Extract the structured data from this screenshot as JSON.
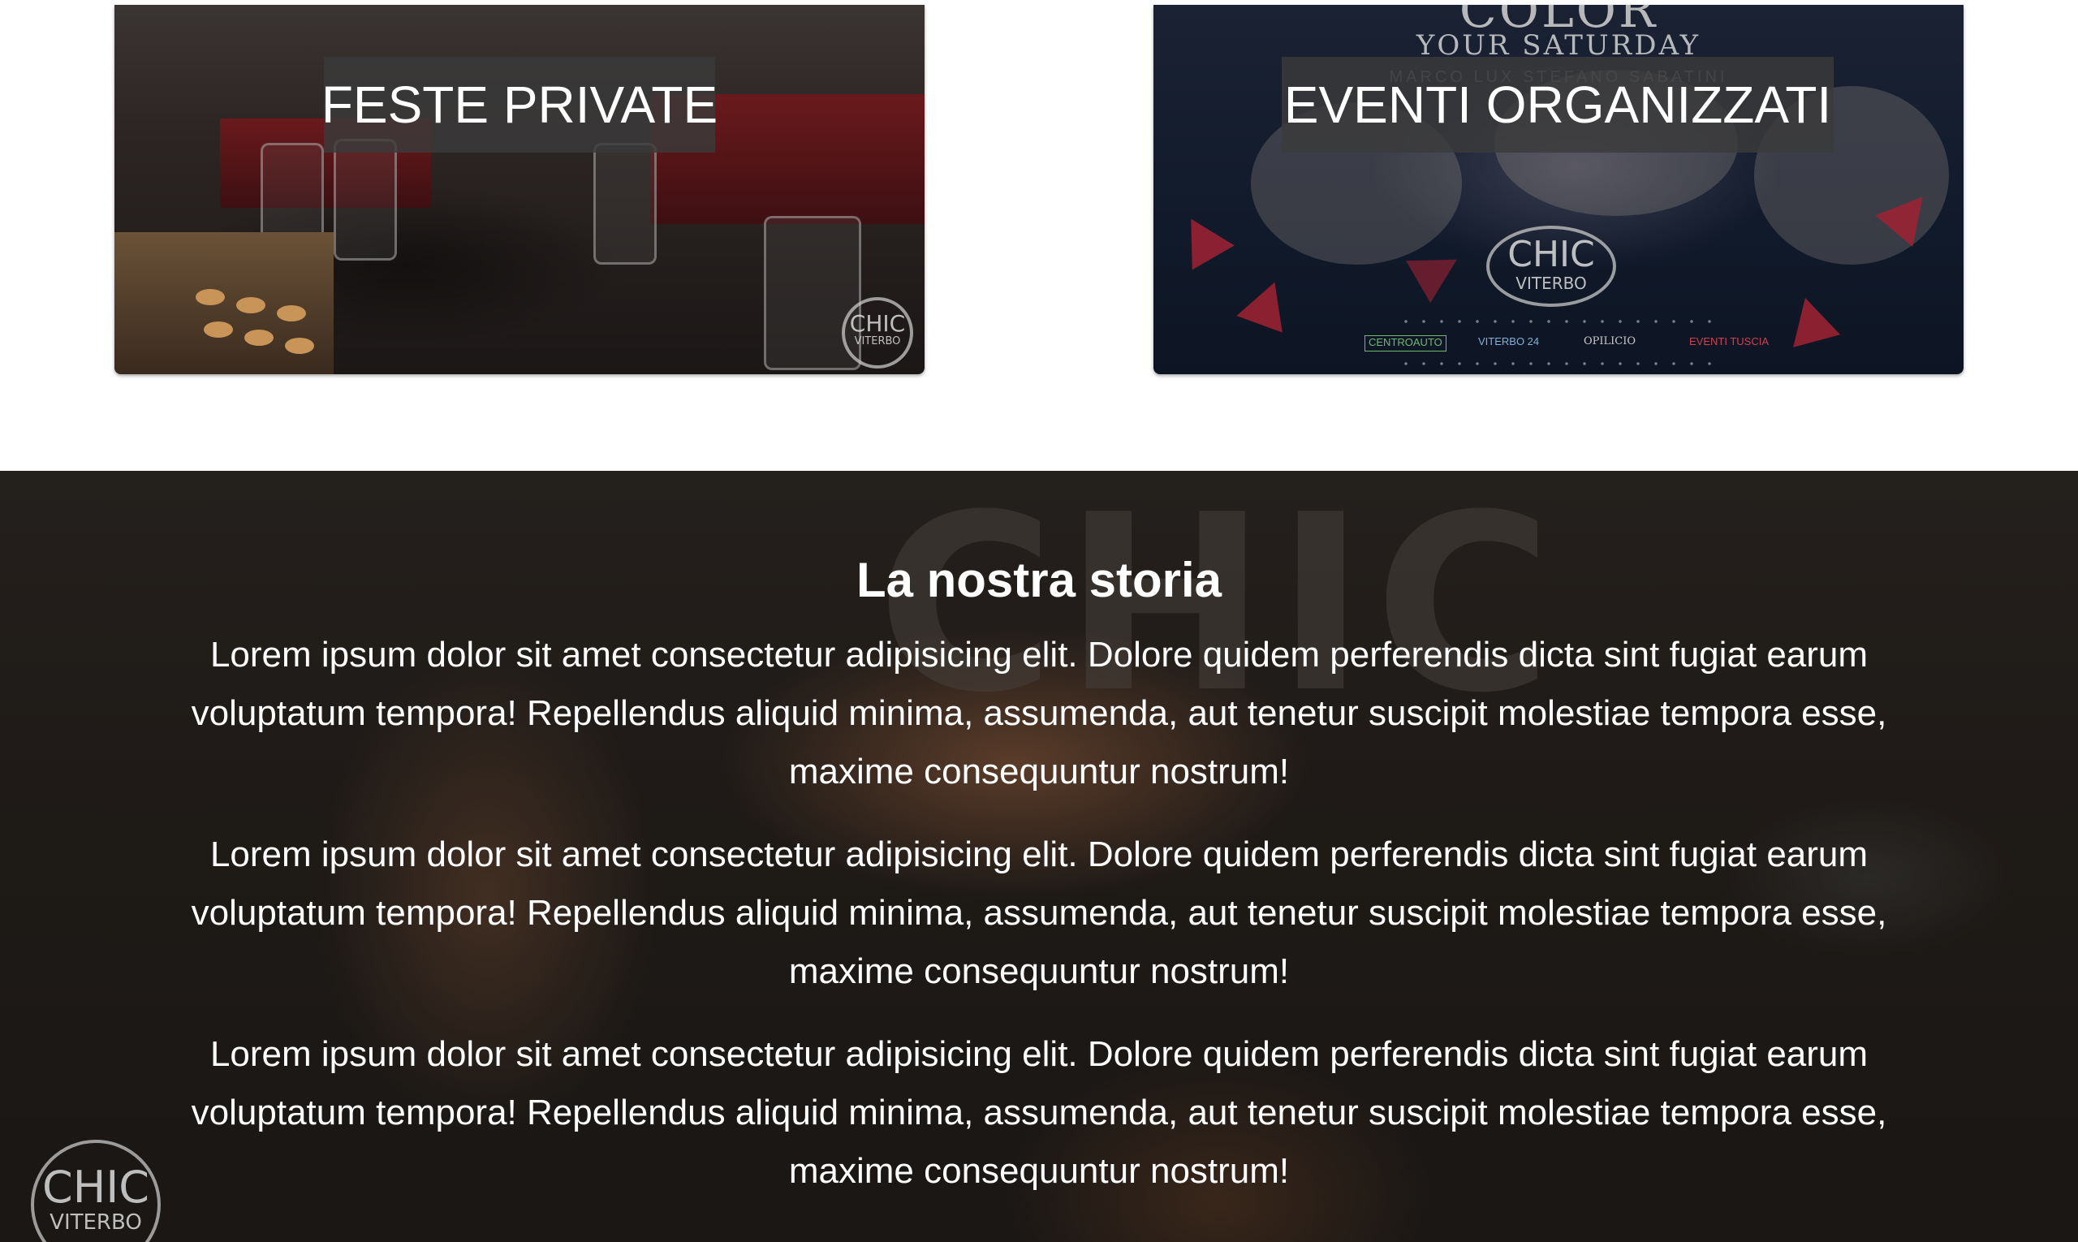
{
  "cards": [
    {
      "id": "private",
      "title": "FESTE PRIVATE",
      "logo": {
        "top": "CHIC",
        "bottom": "VITERBO"
      }
    },
    {
      "id": "events",
      "title": "EVENTI ORGANIZZATI",
      "poster": {
        "headline": "COLOR",
        "subtitle": "YOUR SATURDAY",
        "djs": "MARCO LUX  STEFANO SABATINI",
        "logo": {
          "top": "CHIC",
          "bottom": "VITERBO"
        },
        "sponsors": [
          "CENTROAUTO",
          "VITERBO 24",
          "OPILICIO",
          "EVENTI TUSCIA"
        ]
      }
    }
  ],
  "story": {
    "background_sign": "CHIC",
    "title": "La nostra storia",
    "paragraphs": [
      "Lorem ipsum dolor sit amet consectetur adipisicing elit. Dolore quidem perferendis dicta sint fugiat earum voluptatum tempora! Repellendus aliquid minima, assumenda, aut tenetur suscipit molestiae tempora esse, maxime consequuntur nostrum!",
      "Lorem ipsum dolor sit amet consectetur adipisicing elit. Dolore quidem perferendis dicta sint fugiat earum voluptatum tempora! Repellendus aliquid minima, assumenda, aut tenetur suscipit molestiae tempora esse, maxime consequuntur nostrum!",
      "Lorem ipsum dolor sit amet consectetur adipisicing elit. Dolore quidem perferendis dicta sint fugiat earum voluptatum tempora! Repellendus aliquid minima, assumenda, aut tenetur suscipit molestiae tempora esse, maxime consequuntur nostrum!"
    ],
    "logo": {
      "top": "CHIC",
      "bottom": "VITERBO"
    }
  },
  "colors": {
    "page_background": "#ffffff",
    "title_box": "#3a3a3a",
    "title_text": "#ffffff",
    "story_text": "#ffffff",
    "event_accent": "#a02232"
  }
}
